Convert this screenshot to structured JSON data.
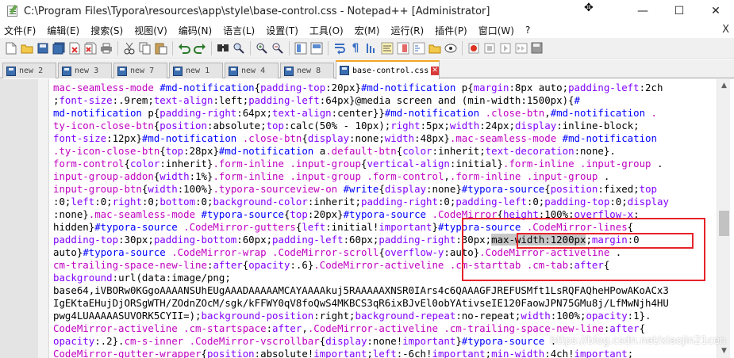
{
  "window": {
    "title": "C:\\Program Files\\Typora\\resources\\app\\style\\base-control.css - Notepad++ [Administrator]",
    "minimize": "—",
    "maximize": "☐",
    "close": "✕"
  },
  "cursor_glyph": "✥",
  "menu": {
    "items": [
      "文件(F)",
      "编辑(E)",
      "搜索(S)",
      "视图(V)",
      "编码(N)",
      "语言(L)",
      "设置(T)",
      "工具(O)",
      "宏(M)",
      "运行(R)",
      "插件(P)",
      "窗口(W)",
      "?"
    ],
    "close_glyph": "X"
  },
  "tabs": [
    {
      "label": "new 2",
      "active": false
    },
    {
      "label": "new 3",
      "active": false
    },
    {
      "label": "new 7",
      "active": false
    },
    {
      "label": "new 1",
      "active": false
    },
    {
      "label": "new 4",
      "active": false
    },
    {
      "label": "new 8",
      "active": false
    },
    {
      "label": "base-control.css",
      "active": true
    }
  ],
  "tab_close_glyph": "✕",
  "toolbar_icons": [
    "new-file-icon",
    "open-file-icon",
    "save-icon",
    "save-all-icon",
    "close-icon",
    "close-all-icon",
    "print-icon",
    "cut-icon",
    "copy-icon",
    "paste-icon",
    "undo-icon",
    "redo-icon",
    "find-icon",
    "replace-icon",
    "zoom-in-icon",
    "zoom-out-icon",
    "sync-vertical-icon",
    "sync-horizontal-icon",
    "word-wrap-icon",
    "show-all-chars-icon",
    "indent-guide-icon",
    "udl-icon",
    "doc-map-icon",
    "function-list-icon",
    "folder-workspace-icon",
    "monitoring-icon",
    "record-macro-icon",
    "stop-record-icon",
    "play-macro-icon",
    "play-multiple-icon",
    "save-macro-icon"
  ],
  "scroll": {
    "up": "▲",
    "down": "▼"
  },
  "watermark": "https://blog.csdn.net/xiaojin21cen",
  "code_lines": [
    [
      [
        "cls",
        "mac-seamless-mode "
      ],
      [
        "sel",
        "#md-notification"
      ],
      [
        "",
        "{"
      ],
      [
        "prop",
        "padding-top"
      ],
      [
        "",
        ":20px}"
      ],
      [
        "sel",
        "#md-notification "
      ],
      [
        "",
        "p{"
      ],
      [
        "prop",
        "margin"
      ],
      [
        "",
        ":8px auto;"
      ],
      [
        "prop",
        "padding-left"
      ],
      [
        "",
        ":2ch"
      ]
    ],
    [
      [
        "",
        ";"
      ],
      [
        "prop",
        "font-size"
      ],
      [
        "",
        ":.9rem;"
      ],
      [
        "prop",
        "text-align"
      ],
      [
        "",
        ":left;"
      ],
      [
        "prop",
        "padding-left"
      ],
      [
        "",
        ":64px}@media screen and (min-width:1500px){"
      ],
      [
        "sel",
        "#"
      ]
    ],
    [
      [
        "sel",
        "md-notification "
      ],
      [
        "",
        "p{"
      ],
      [
        "prop",
        "padding-right"
      ],
      [
        "",
        ":64px;"
      ],
      [
        "prop",
        "text-align"
      ],
      [
        "",
        ":center}}"
      ],
      [
        "sel",
        "#md-notification "
      ],
      [
        "cls",
        ".close-btn"
      ],
      [
        "",
        ","
      ],
      [
        "sel",
        "#md-notification "
      ],
      [
        "cls",
        "."
      ]
    ],
    [
      [
        "cls",
        "ty-icon-close-btn"
      ],
      [
        "",
        "{"
      ],
      [
        "prop",
        "position"
      ],
      [
        "",
        ":absolute;"
      ],
      [
        "prop",
        "top"
      ],
      [
        "",
        ":calc(50% - 10px);"
      ],
      [
        "prop",
        "right"
      ],
      [
        "",
        ":5px;"
      ],
      [
        "prop",
        "width"
      ],
      [
        "",
        ":24px;"
      ],
      [
        "prop",
        "display"
      ],
      [
        "",
        ":inline-block;"
      ]
    ],
    [
      [
        "prop",
        "font-size"
      ],
      [
        "",
        ":12px}"
      ],
      [
        "sel",
        "#md-notification "
      ],
      [
        "cls",
        ".close-btn"
      ],
      [
        "",
        "{"
      ],
      [
        "prop",
        "display"
      ],
      [
        "",
        ":none;"
      ],
      [
        "prop",
        "width"
      ],
      [
        "",
        ":48px}"
      ],
      [
        "cls",
        ".mac-seamless-mode "
      ],
      [
        "sel",
        "#md-notification"
      ]
    ],
    [
      [
        "cls",
        ".ty-icon-close-btn"
      ],
      [
        "",
        "{"
      ],
      [
        "prop",
        "top"
      ],
      [
        "",
        ":28px}"
      ],
      [
        "sel",
        "#md-notification "
      ],
      [
        "",
        "a"
      ],
      [
        "cls",
        ".default-btn"
      ],
      [
        "",
        "{"
      ],
      [
        "prop",
        "color"
      ],
      [
        "",
        ":inherit;"
      ],
      [
        "prop",
        "text-decoration"
      ],
      [
        "",
        ":none}."
      ]
    ],
    [
      [
        "cls",
        "form-control"
      ],
      [
        "",
        "{"
      ],
      [
        "prop",
        "color"
      ],
      [
        "",
        ":inherit}"
      ],
      [
        "cls",
        ".form-inline "
      ],
      [
        "cls",
        ".input-group"
      ],
      [
        "",
        "{"
      ],
      [
        "prop",
        "vertical-align"
      ],
      [
        "",
        ":initial}"
      ],
      [
        "cls",
        ".form-inline "
      ],
      [
        "cls",
        ".input-group "
      ],
      [
        "",
        "."
      ]
    ],
    [
      [
        "cls",
        "input-group-addon"
      ],
      [
        "",
        "{"
      ],
      [
        "prop",
        "width"
      ],
      [
        "",
        ":1%}"
      ],
      [
        "cls",
        ".form-inline "
      ],
      [
        "cls",
        ".input-group "
      ],
      [
        "cls",
        ".form-control"
      ],
      [
        "",
        ","
      ],
      [
        "cls",
        ".form-inline "
      ],
      [
        "cls",
        ".input-group "
      ],
      [
        "",
        "."
      ]
    ],
    [
      [
        "cls",
        "input-group-btn"
      ],
      [
        "",
        "{"
      ],
      [
        "prop",
        "width"
      ],
      [
        "",
        ":100%}"
      ],
      [
        "cls",
        ".typora-sourceview-on "
      ],
      [
        "sel",
        "#write"
      ],
      [
        "",
        "{"
      ],
      [
        "prop",
        "display"
      ],
      [
        "",
        ":none}"
      ],
      [
        "sel",
        "#typora-source"
      ],
      [
        "",
        "{"
      ],
      [
        "prop",
        "position"
      ],
      [
        "",
        ":fixed;"
      ],
      [
        "prop",
        "top"
      ]
    ],
    [
      [
        "",
        ":0;"
      ],
      [
        "prop",
        "left"
      ],
      [
        "",
        ":0;"
      ],
      [
        "prop",
        "right"
      ],
      [
        "",
        ":0;"
      ],
      [
        "prop",
        "bottom"
      ],
      [
        "",
        ":0;"
      ],
      [
        "prop",
        "background-color"
      ],
      [
        "",
        ":inherit;"
      ],
      [
        "prop",
        "padding-right"
      ],
      [
        "",
        ":0;"
      ],
      [
        "prop",
        "padding-left"
      ],
      [
        "",
        ":0;"
      ],
      [
        "prop",
        "padding-top"
      ],
      [
        "",
        ":0;"
      ],
      [
        "prop",
        "display"
      ]
    ],
    [
      [
        "",
        ":none}"
      ],
      [
        "cls",
        ".mac-seamless-mode "
      ],
      [
        "sel",
        "#typora-source"
      ],
      [
        "",
        "{"
      ],
      [
        "prop",
        "top"
      ],
      [
        "",
        ":20px}"
      ],
      [
        "sel",
        "#typora-source "
      ],
      [
        "cls",
        ".CodeMirror"
      ],
      [
        "",
        "{"
      ],
      [
        "prop",
        "height"
      ],
      [
        "",
        ":100%;"
      ],
      [
        "prop",
        "overflow-x"
      ],
      [
        "",
        ":"
      ]
    ],
    [
      [
        "",
        "hidden}"
      ],
      [
        "sel",
        "#typora-source "
      ],
      [
        "cls",
        ".CodeMirror-gutters"
      ],
      [
        "",
        "{"
      ],
      [
        "prop",
        "left"
      ],
      [
        "",
        ":initial!"
      ],
      [
        "prop",
        "important"
      ],
      [
        "",
        "}"
      ],
      [
        "sel",
        "#typora-source "
      ],
      [
        "cls",
        ".CodeMirror-lines"
      ],
      [
        "",
        "{"
      ]
    ],
    [
      [
        "prop",
        "padding-top"
      ],
      [
        "",
        ":30px;"
      ],
      [
        "prop",
        "padding-bottom"
      ],
      [
        "",
        ":60px;"
      ],
      [
        "prop",
        "padding-left"
      ],
      [
        "",
        ":60px;"
      ],
      [
        "prop",
        "padding-right"
      ],
      [
        "",
        ":30px;"
      ],
      [
        "hl",
        "max-width:"
      ],
      [
        "hl",
        "1200px"
      ],
      [
        "",
        ";"
      ],
      [
        "prop",
        "margin"
      ],
      [
        "",
        ":0"
      ]
    ],
    [
      [
        "",
        "auto}"
      ],
      [
        "sel",
        "#typora-source "
      ],
      [
        "cls",
        ".CodeMirror-wrap "
      ],
      [
        "cls",
        ".CodeMirror-scroll"
      ],
      [
        "",
        "{"
      ],
      [
        "prop",
        "overflow-y"
      ],
      [
        "",
        ":auto}"
      ],
      [
        "cls",
        ".CodeMirror-activeline "
      ],
      [
        "",
        "."
      ]
    ],
    [
      [
        "cls",
        "cm-trailing-space-new-line"
      ],
      [
        "",
        ":"
      ],
      [
        "prop",
        "after"
      ],
      [
        "",
        "{"
      ],
      [
        "prop",
        "opacity"
      ],
      [
        "",
        ":.6}"
      ],
      [
        "cls",
        ".CodeMirror-activeline "
      ],
      [
        "cls",
        ".cm-starttab "
      ],
      [
        "cls",
        ".cm-tab"
      ],
      [
        "",
        ":"
      ],
      [
        "prop",
        "after"
      ],
      [
        "",
        "{"
      ]
    ],
    [
      [
        "prop",
        "background"
      ],
      [
        "",
        ":url(data:image/png;"
      ]
    ],
    [
      [
        "",
        "base64,iVBORw0KGgoAAAANSUhEUgAAADAAAAAMCAYAAAAkuj5RAAAAAXNSR0IArs4c6QAAAGFJREFUSMft1LsRQFAQheHPowAKoACx3"
      ]
    ],
    [
      [
        "",
        "IgEKtaEHujDjORSgWTH/ZOdnZOcM/sgk/kFFWY0qV8foQwS4MKBCS3qR6ixBJvEl0obYAtivseIE120FaowJPN75GMu8j/LfMwNjh4HU"
      ]
    ],
    [
      [
        "",
        "pwg4LUAAAAASUVORK5CYII=)"
      ],
      [
        "",
        ";"
      ],
      [
        "prop",
        "background-position"
      ],
      [
        "",
        ":right;"
      ],
      [
        "prop",
        "background-repeat"
      ],
      [
        "",
        ":no-repeat;"
      ],
      [
        "prop",
        "width"
      ],
      [
        "",
        ":100%;"
      ],
      [
        "prop",
        "opacity"
      ],
      [
        "",
        ":1}."
      ]
    ],
    [
      [
        "cls",
        "CodeMirror-activeline "
      ],
      [
        "cls",
        ".cm-startspace"
      ],
      [
        "",
        ":"
      ],
      [
        "prop",
        "after"
      ],
      [
        "",
        ","
      ],
      [
        "cls",
        ".CodeMirror-activeline "
      ],
      [
        "cls",
        ".cm-trailing-space-new-line"
      ],
      [
        "",
        ":"
      ],
      [
        "prop",
        "after"
      ],
      [
        "",
        "{"
      ]
    ],
    [
      [
        "prop",
        "opacity"
      ],
      [
        "",
        ":.2}."
      ],
      [
        "cls",
        "cm-s-inner "
      ],
      [
        "cls",
        ".CodeMirror-vscrollbar"
      ],
      [
        "",
        "{"
      ],
      [
        "prop",
        "display"
      ],
      [
        "",
        ":none!"
      ],
      [
        "prop",
        "important"
      ],
      [
        "",
        "}"
      ],
      [
        "sel",
        "#typora-source "
      ],
      [
        "",
        "."
      ]
    ],
    [
      [
        "cls",
        "CodeMirror-gutter-wrapper"
      ],
      [
        "",
        "{"
      ],
      [
        "prop",
        "position"
      ],
      [
        "",
        ":absolute!"
      ],
      [
        "prop",
        "important"
      ],
      [
        "",
        ";"
      ],
      [
        "prop",
        "left"
      ],
      [
        "",
        ":-6ch!"
      ],
      [
        "prop",
        "important"
      ],
      [
        "",
        ";"
      ],
      [
        "prop",
        "min-width"
      ],
      [
        "",
        ":4ch!"
      ],
      [
        "prop",
        "important"
      ],
      [
        "",
        ";"
      ]
    ]
  ]
}
